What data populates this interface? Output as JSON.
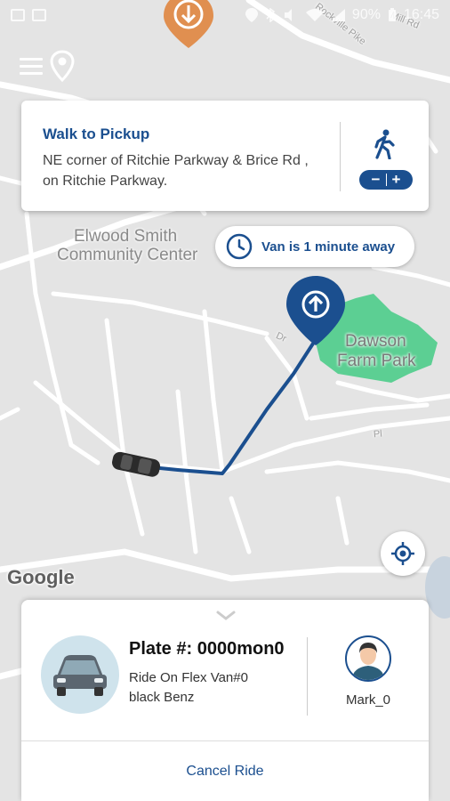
{
  "statusbar": {
    "battery": "90%",
    "time": "16:45"
  },
  "map": {
    "labels": {
      "community_center_line1": "Elwood Smith",
      "community_center_line2": "Community Center",
      "park_line1": "Dawson",
      "park_line2": "Farm Park",
      "road_pike": "Rockville Pike",
      "road_mill": "Mill Rd",
      "road_dr": "Dr",
      "road_pl": "Pl"
    },
    "colors": {
      "park": "#5ccf93",
      "route": "#1b4f8f",
      "road": "#ffffff",
      "map_bg": "#e4e4e4"
    },
    "logo": "Google"
  },
  "walk_card": {
    "title": "Walk to Pickup",
    "address": "NE corner of Ritchie Parkway & Brice Rd , on Ritchie Parkway.",
    "zoom_minus": "−",
    "zoom_plus": "+"
  },
  "van_eta": {
    "text": "Van is 1 minute away"
  },
  "ride": {
    "plate": "Plate #: 0000mon0",
    "name": "Ride On Flex Van#0",
    "description": "black Benz",
    "driver": "Mark_0"
  },
  "actions": {
    "cancel": "Cancel Ride"
  },
  "icons": {
    "menu": "menu-icon",
    "location_pin": "location-pin-icon",
    "walk": "walking-person-icon",
    "clock": "clock-icon",
    "pickup": "pickup-pin-icon",
    "car": "car-icon",
    "locate": "my-location-icon",
    "chevron": "chevron-down-icon",
    "driver": "driver-avatar-icon"
  }
}
